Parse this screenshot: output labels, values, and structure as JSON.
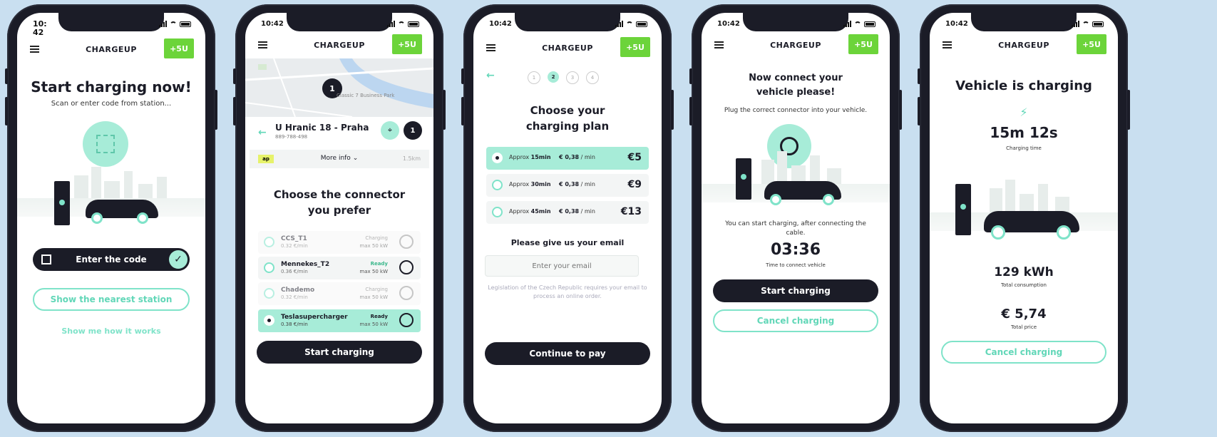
{
  "brand": {
    "logo": "CHARGEUP",
    "badge": "+5U",
    "accent": "#7fe3c9",
    "dark": "#1b1c27",
    "badge_color": "#6cd43a"
  },
  "screen1": {
    "time": "10:\n42",
    "title": "Start charging now!",
    "subtitle": "Scan or enter code from station...",
    "code_button": "Enter the code",
    "nearest_button": "Show the nearest station",
    "how_link": "Show me how it works"
  },
  "screen2": {
    "time": "10:42",
    "map_pin": "1",
    "map_label": "Classic 7 Business Park",
    "station_name": "U Hranic 18 - Praha",
    "station_phone": "889-788-498",
    "station_count": "1",
    "more_info": "More info",
    "distance": "1.5km",
    "title_line1": "Choose the connector",
    "title_line2": "you prefer",
    "connectors": [
      {
        "name": "CCS_T1",
        "price": "0.32 €/min",
        "state": "Charging",
        "max": "max 50 kW"
      },
      {
        "name": "Mennekes_T2",
        "price": "0.36 €/min",
        "state": "Ready",
        "max": "max 50 kW"
      },
      {
        "name": "Chademo",
        "price": "0.32 €/min",
        "state": "Charging",
        "max": "max 50 kW"
      },
      {
        "name": "Teslasupercharger",
        "price": "0.38 €/min",
        "state": "Ready",
        "max": "max 50 kW"
      }
    ],
    "start_button": "Start charging"
  },
  "screen3": {
    "time": "10:42",
    "steps": [
      "1",
      "2",
      "3",
      "4"
    ],
    "title_line1": "Choose your",
    "title_line2": "charging plan",
    "plans": [
      {
        "label": "Approx",
        "dur": "15min",
        "price": "€ 0,38",
        "unit": " / min",
        "amount": "€5"
      },
      {
        "label": "Approx",
        "dur": "30min",
        "price": "€ 0,38",
        "unit": " / min",
        "amount": "€9"
      },
      {
        "label": "Approx",
        "dur": "45min",
        "price": "€ 0,38",
        "unit": " / min",
        "amount": "€13"
      }
    ],
    "email_title": "Please give us your email",
    "email_placeholder": "Enter your email",
    "legal": "Legislation of the Czech Republic requires your email to process an online order.",
    "continue_button": "Continue to pay"
  },
  "screen4": {
    "time": "10:42",
    "title_line1": "Now connect your",
    "title_line2": "vehicle please!",
    "subtitle": "Plug the correct connector into your vehicle.",
    "info": "You can start charging, after connecting the cable.",
    "timer": "03:36",
    "timer_label": "Time to connect vehicle",
    "start_button": "Start charging",
    "cancel_button": "Cancel charging"
  },
  "screen5": {
    "time": "10:42",
    "title": "Vehicle is charging",
    "time_value": "15m 12s",
    "time_label": "Charging time",
    "kwh": "129 kWh",
    "kwh_label": "Total consumption",
    "price": "€ 5,74",
    "price_label": "Total price",
    "cancel_button": "Cancel charging"
  }
}
